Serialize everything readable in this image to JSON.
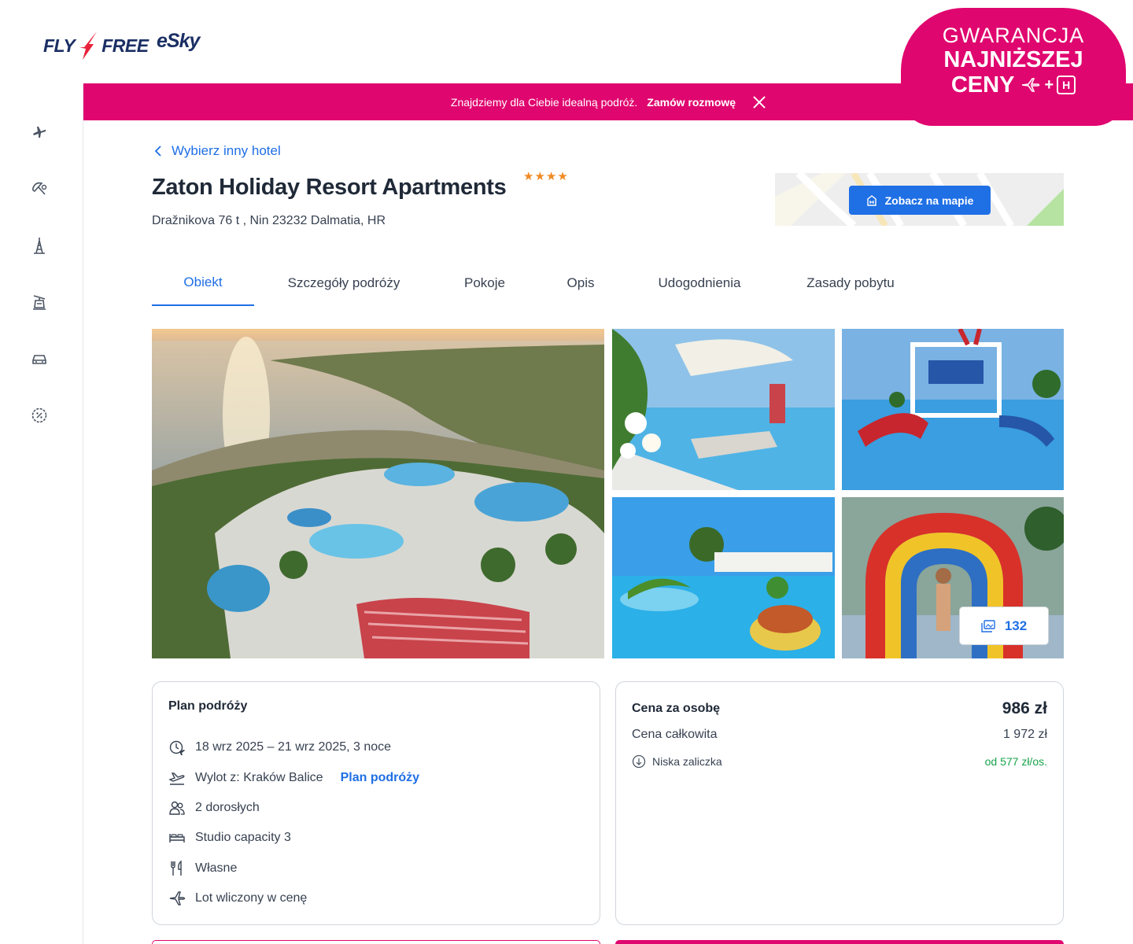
{
  "header": {
    "logo_flyfree_left": "FLY",
    "logo_flyfree_right": "FREE",
    "logo_esky": "eSky",
    "guarantee_line1": "GWARANCJA",
    "guarantee_line2": "NAJNIŻSZEJ",
    "guarantee_line3": "CENY",
    "guarantee_plus": "+",
    "guarantee_hotel_letter": "H"
  },
  "promo": {
    "text": "Znajdziemy dla Ciebie idealną podróż.",
    "cta": "Zamów rozmowę"
  },
  "sidebar": {
    "icons": [
      "plane-icon",
      "beach-umbrella-icon",
      "city-tower-icon",
      "ski-lift-icon",
      "car-icon",
      "discount-badge-icon"
    ]
  },
  "hotel": {
    "back_link": "Wybierz inny hotel",
    "name": "Zaton Holiday Resort Apartments",
    "stars": "★★★★",
    "star_rating": 4,
    "address": "Dražnikova 76 t , Nin 23232 Dalmatia, HR",
    "map_button": "Zobacz na mapie"
  },
  "tabs": [
    {
      "label": "Obiekt",
      "active": true
    },
    {
      "label": "Szczegóły podróży",
      "active": false
    },
    {
      "label": "Pokoje",
      "active": false
    },
    {
      "label": "Opis",
      "active": false
    },
    {
      "label": "Udogodnienia",
      "active": false
    },
    {
      "label": "Zasady pobytu",
      "active": false
    }
  ],
  "gallery": {
    "photo_count": "132"
  },
  "plan": {
    "title": "Plan podróży",
    "dates": "18 wrz 2025 – 21 wrz 2025, 3 noce",
    "departure": "Wylot z: Kraków Balice",
    "departure_link": "Plan podróży",
    "travelers": "2 dorosłych",
    "room": "Studio capacity 3",
    "board": "Własne",
    "flight": "Lot wliczony w cenę"
  },
  "price": {
    "per_person_label": "Cena za osobę",
    "per_person_value": "986 zł",
    "total_label": "Cena całkowita",
    "total_value": "1 972 zł",
    "deposit_label": "Niska zaliczka",
    "deposit_value": "od 577 zł/os."
  },
  "colors": {
    "brand_pink": "#e0066f",
    "accent_blue": "#1f6fe5",
    "star_orange": "#f08a24",
    "deposit_green": "#17a34a",
    "logo_navy": "#1b2f64"
  }
}
